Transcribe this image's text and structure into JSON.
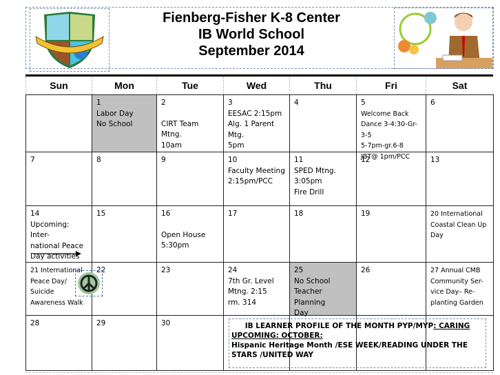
{
  "header": {
    "line1": "Fienberg-Fisher K-8 Center",
    "line2": "IB World School",
    "line3": "September 2014",
    "logo_text": "FIENBERG FISHER K-8 CENTER"
  },
  "days": [
    "Sun",
    "Mon",
    "Tue",
    "Wed",
    "Thu",
    "Fri",
    "Sat"
  ],
  "weeks": [
    [
      {
        "d": "",
        "t": []
      },
      {
        "d": "1",
        "t": [
          "Labor Day",
          "No School"
        ],
        "gray": true
      },
      {
        "d": "2",
        "t": [
          "",
          "CIRT Team Mtng.",
          "10am"
        ]
      },
      {
        "d": "3",
        "t": [
          "EESAC 2:15pm",
          "Alg. 1 Parent Mtg.",
          "5pm"
        ]
      },
      {
        "d": "4",
        "t": []
      },
      {
        "d": "5",
        "t": [
          "Welcome Back",
          "Dance 3-4:30-Gr-3-5",
          "5-7pm-gr.6-8",
          "JBT@ 1pm/PCC"
        ],
        "comic": true
      },
      {
        "d": "6",
        "t": []
      }
    ],
    [
      {
        "d": "7",
        "t": []
      },
      {
        "d": "8",
        "t": []
      },
      {
        "d": "9",
        "t": []
      },
      {
        "d": "10",
        "t": [
          "Faculty Meeting",
          "2:15pm/PCC"
        ]
      },
      {
        "d": "11",
        "t": [
          "SPED Mtng.",
          "3:05pm",
          "Fire Drill"
        ]
      },
      {
        "d": "12",
        "t": []
      },
      {
        "d": "13",
        "t": []
      }
    ],
    [
      {
        "d": "14",
        "t": [
          "Upcoming: Inter-",
          "national Peace",
          "Day activities"
        ]
      },
      {
        "d": "15",
        "t": []
      },
      {
        "d": "16",
        "t": [
          "",
          "Open House",
          "5:30pm"
        ]
      },
      {
        "d": "17",
        "t": []
      },
      {
        "d": "18",
        "t": []
      },
      {
        "d": "19",
        "t": []
      },
      {
        "d": "20 International",
        "t": [
          "Coastal Clean Up",
          "Day"
        ],
        "comic": true
      }
    ],
    [
      {
        "d": "21 International",
        "t": [
          "Peace Day/",
          "Suicide",
          "Awareness Walk"
        ],
        "comic": true
      },
      {
        "d": "22",
        "t": []
      },
      {
        "d": "23",
        "t": []
      },
      {
        "d": "24",
        "t": [
          "7th Gr. Level",
          "Mtng. 2:15",
          "rm. 314"
        ]
      },
      {
        "d": "25",
        "t": [
          "No School",
          "Teacher Planning",
          "Day"
        ],
        "gray": true
      },
      {
        "d": "26",
        "t": []
      },
      {
        "d": "27 Annual CMB",
        "t": [
          "Community Ser-",
          "vice Day– Re-",
          "planting Garden"
        ],
        "comic": true
      }
    ],
    [
      {
        "d": "28",
        "t": []
      },
      {
        "d": "29",
        "t": []
      },
      {
        "d": "30",
        "t": []
      },
      {
        "d": "",
        "t": []
      },
      {
        "d": "",
        "t": []
      },
      {
        "d": "",
        "t": []
      },
      {
        "d": "",
        "t": []
      }
    ]
  ],
  "banner": {
    "line1a": "IB LEARNER PROFILE OF THE MONTH PYP/MYP",
    "line1b": ": CARING",
    "line2": "UPCOMING: OCTOBER:",
    "line3": "Hispanic Heritage Month /ESE WEEK/READING UNDER THE STARS /UNITED WAY"
  }
}
